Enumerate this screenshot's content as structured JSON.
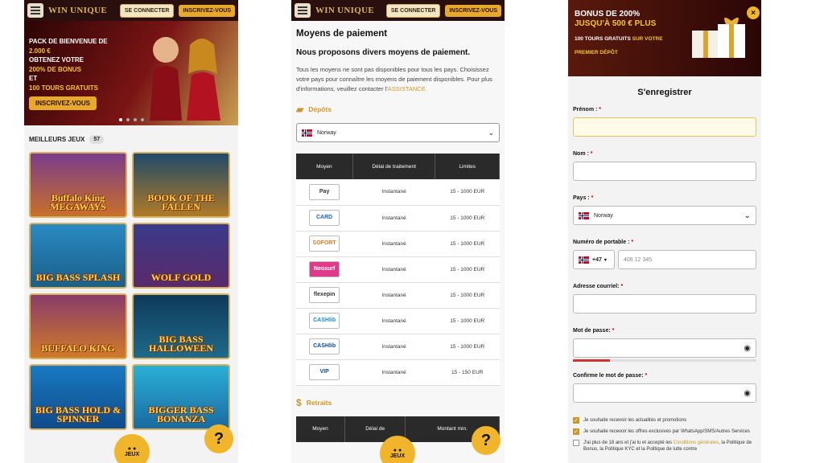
{
  "header": {
    "logo": "WIN UNIQUE",
    "logo_sub": "CASINO",
    "login": "SE CONNECTER",
    "register": "INSCRIVEZ-VOUS"
  },
  "hero": {
    "line1": "PACK DE BIENVENUE DE",
    "line2": "2.000 €",
    "line3": "OBTENEZ VOTRE",
    "line4": "200% DE BONUS",
    "line5": "ET",
    "line6": "100 TOURS GRATUITS",
    "cta": "INSCRIVEZ-VOUS"
  },
  "games": {
    "title": "MEILLEURS JEUX",
    "count": "57",
    "tiles": [
      {
        "name": "Buffalo King MEGAWAYS"
      },
      {
        "name": "BOOK OF THE FALLEN"
      },
      {
        "name": "BIG BASS SPLASH"
      },
      {
        "name": "WOLF GOLD"
      },
      {
        "name": "BUFFALO KING"
      },
      {
        "name": "BIG BASS HALLOWEEN"
      },
      {
        "name": "BIG BASS HOLD & SPINNER"
      },
      {
        "name": "BIGGER BASS BONANZA"
      }
    ],
    "fab_jeux": "JEUX",
    "fab_help": "?"
  },
  "payment": {
    "title": "Moyens de paiement",
    "subtitle": "Nous proposons divers moyens de paiement.",
    "text": "Tous les moyens ne sont pas disponibles pour tous les pays. Choisissez votre pays pour connaître les moyens de paiement disponibles. Pour plus d'informations, veuillez contacter l'",
    "link": "ASSISTANCE.",
    "deposits": "Dépôts",
    "withdrawals": "Retraits",
    "country": "Norway",
    "headers": [
      "Moyen",
      "Délai de traitement",
      "Limites"
    ],
    "headers2": [
      "Moyen",
      "Délai de",
      "Montant min."
    ],
    "rows": [
      {
        "method": "Pay",
        "delay": "Instantané",
        "limits": "15 - 1000 EUR"
      },
      {
        "method": "CARD",
        "delay": "Instantané",
        "limits": "15 - 1000 EUR"
      },
      {
        "method": "SOFORT",
        "delay": "Instantané",
        "limits": "15 - 1000 EUR"
      },
      {
        "method": "Neosurf",
        "delay": "Instantané",
        "limits": "15 - 1000 EUR"
      },
      {
        "method": "flexepin",
        "delay": "Instantané",
        "limits": "15 - 1000 EUR"
      },
      {
        "method": "CASHlib",
        "delay": "Instantané",
        "limits": "15 - 1000 EUR"
      },
      {
        "method": "CASHlib",
        "delay": "Instantané",
        "limits": "15 - 1000 EUR"
      },
      {
        "method": "VIP",
        "delay": "Instantané",
        "limits": "15 - 150 EUR"
      }
    ]
  },
  "signup": {
    "bonus1": "BONUS DE 200%",
    "bonus2": "JUSQU'À 500 € PLUS",
    "bonus3": "100 TOURS GRATUITS",
    "bonus3b": "SUR VOTRE",
    "bonus4": "PREMIER DÉPÔT",
    "title": "S'enregistrer",
    "prenom": "Prénom :",
    "nom": "Nom :",
    "pays": "Pays :",
    "pays_value": "Norway",
    "phone": "Numéro de portable :",
    "phone_code": "+47",
    "phone_placeholder": "406 12 345",
    "email": "Adresse courriel:",
    "password": "Mot de passe:",
    "confirm": "Confirme le mot de passe:",
    "check1": "Je souhaite recevoir les actualités et promotions",
    "check2": "Je souhaite recevoir les offres exclusives par WhatsApp/SMS/Autres Services",
    "check3a": "J'ai plus de 18 ans et j'ai lu et accepté les ",
    "check3b": "Conditions générales",
    "check3c": ", la Politique de Bonus, la Politique KYC et la Politique de lutte contre"
  }
}
